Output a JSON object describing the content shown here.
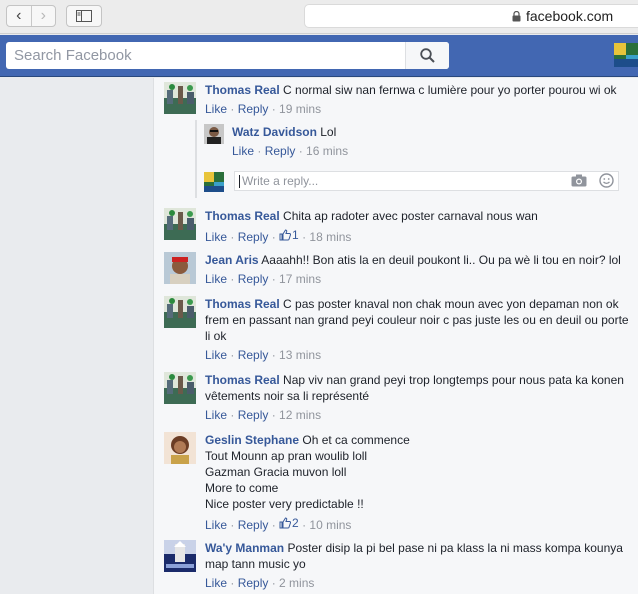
{
  "browser": {
    "url": "facebook.com",
    "back_glyph": "‹",
    "forward_glyph": "›"
  },
  "header": {
    "search_placeholder": "Search Facebook"
  },
  "colors": {
    "brand": "#4267b2",
    "link": "#365899",
    "muted": "#90949c"
  },
  "comments": [
    {
      "author": "Thomas Real",
      "text": "C normal siw nan fernwa c lumière pour yo porter pourou wi ok",
      "like": "Like",
      "reply": "Reply",
      "time": "19 mins",
      "replies": [
        {
          "author": "Watz Davidson",
          "text": "Lol",
          "like": "Like",
          "reply": "Reply",
          "time": "16 mins"
        }
      ],
      "reply_placeholder": "Write a reply..."
    },
    {
      "author": "Thomas Real",
      "text": "Chita ap radoter avec poster carnaval nous wan",
      "like": "Like",
      "reply": "Reply",
      "likes": "1",
      "time": "18 mins"
    },
    {
      "author": "Jean Aris",
      "text": "Aaaahh!! Bon atis la en deuil poukont li.. Ou pa wè li tou en noir? lol",
      "like": "Like",
      "reply": "Reply",
      "time": "17 mins"
    },
    {
      "author": "Thomas Real",
      "text": "C pas poster knaval non chak moun avec yon depaman non ok frem en passant nan grand peyi couleur noir c pas juste les ou en deuil ou porte li ok",
      "like": "Like",
      "reply": "Reply",
      "time": "13 mins"
    },
    {
      "author": "Thomas Real",
      "text": "Nap viv nan grand peyi trop longtemps pour nous pata ka konen vêtements noir sa li représenté",
      "like": "Like",
      "reply": "Reply",
      "time": "12 mins"
    },
    {
      "author": "Geslin Stephane",
      "text": "Oh et ca commence\nTout Mounn ap pran woulib loll\nGazman Gracia muvon loll\nMore to come\nNice poster very predictable !!",
      "like": "Like",
      "reply": "Reply",
      "likes": "2",
      "time": "10 mins"
    },
    {
      "author": "Wa'y Manman",
      "text": "Poster disip la pi bel pase ni pa klass la ni mass kompa kounya map tann music yo",
      "like": "Like",
      "reply": "Reply",
      "time": "2 mins"
    }
  ]
}
